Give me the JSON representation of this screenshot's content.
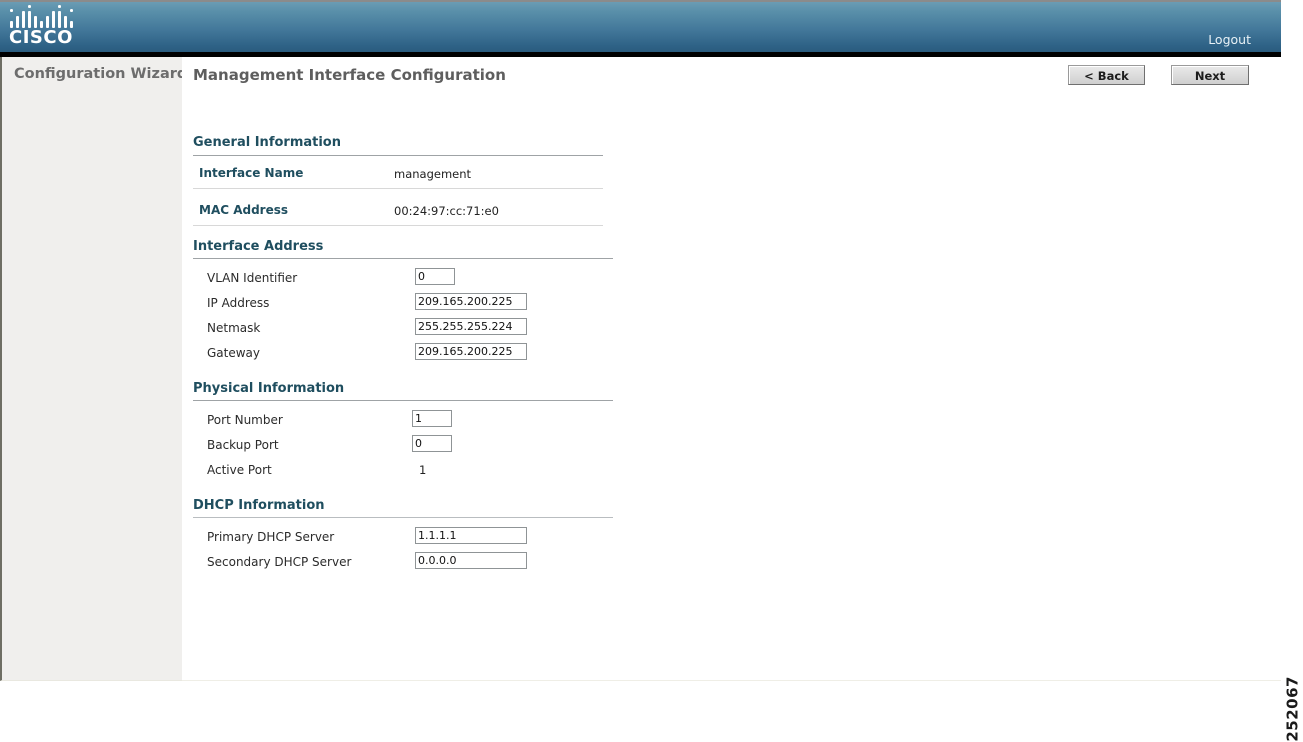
{
  "header": {
    "brand": "CISCO",
    "logo_icon": "cisco-bars-logo",
    "logout_label": "Logout"
  },
  "sidebar": {
    "title": "Configuration Wizard"
  },
  "main": {
    "page_title": "Management Interface Configuration",
    "buttons": {
      "back_label": "< Back",
      "next_label": "Next"
    }
  },
  "sections": {
    "general": {
      "heading": "General Information",
      "rows": [
        {
          "label": "Interface Name",
          "value": "management"
        },
        {
          "label": "MAC Address",
          "value": "00:24:97:cc:71:e0"
        }
      ]
    },
    "interface_address": {
      "heading": "Interface Address",
      "fields": [
        {
          "label": "VLAN Identifier",
          "value": "0"
        },
        {
          "label": "IP Address",
          "value": "209.165.200.225"
        },
        {
          "label": "Netmask",
          "value": "255.255.255.224"
        },
        {
          "label": "Gateway",
          "value": "209.165.200.225"
        }
      ]
    },
    "physical": {
      "heading": "Physical Information",
      "fields": [
        {
          "label": "Port Number",
          "value": "1"
        },
        {
          "label": "Backup Port",
          "value": "0"
        }
      ],
      "static_fields": [
        {
          "label": "Active Port",
          "value": "1"
        }
      ]
    },
    "dhcp": {
      "heading": "DHCP Information",
      "fields": [
        {
          "label": "Primary DHCP Server",
          "value": "1.1.1.1"
        },
        {
          "label": "Secondary DHCP Server",
          "value": "0.0.0.0"
        }
      ]
    }
  },
  "figure_number": "252067",
  "colors": {
    "header_gradient_top": "#6b9cb4",
    "header_gradient_bottom": "#2a5c7e",
    "section_heading": "#1f4e5f",
    "sidebar_bg": "#f0efed",
    "sidebar_text": "#6d6d6d",
    "page_title_text": "#5e5e5e"
  }
}
